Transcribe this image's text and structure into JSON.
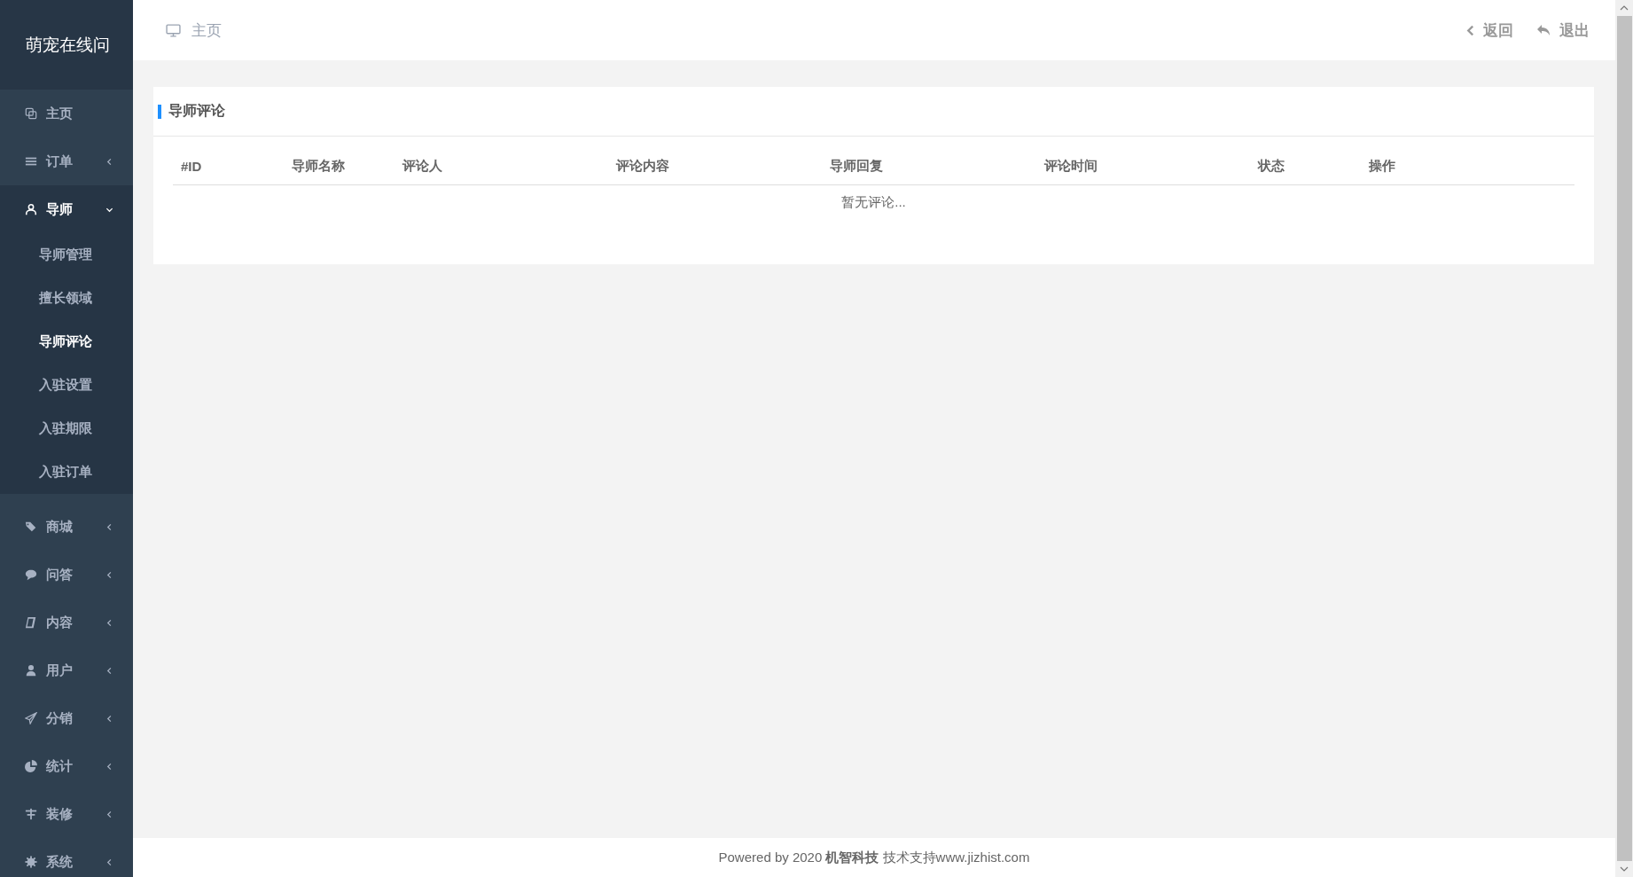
{
  "sidebar": {
    "logo": "萌宠在线问",
    "items": [
      {
        "label": "主页",
        "expanded": false,
        "has_children": false
      },
      {
        "label": "订单",
        "expanded": false,
        "has_children": true
      },
      {
        "label": "导师",
        "expanded": true,
        "has_children": true,
        "children": [
          {
            "label": "导师管理",
            "selected": false
          },
          {
            "label": "擅长领域",
            "selected": false
          },
          {
            "label": "导师评论",
            "selected": true
          },
          {
            "label": "入驻设置",
            "selected": false
          },
          {
            "label": "入驻期限",
            "selected": false
          },
          {
            "label": "入驻订单",
            "selected": false
          }
        ]
      },
      {
        "label": "商城",
        "expanded": false,
        "has_children": true
      },
      {
        "label": "问答",
        "expanded": false,
        "has_children": true
      },
      {
        "label": "内容",
        "expanded": false,
        "has_children": true
      },
      {
        "label": "用户",
        "expanded": false,
        "has_children": true
      },
      {
        "label": "分销",
        "expanded": false,
        "has_children": true
      },
      {
        "label": "统计",
        "expanded": false,
        "has_children": true
      },
      {
        "label": "装修",
        "expanded": false,
        "has_children": true
      },
      {
        "label": "系统",
        "expanded": false,
        "has_children": true
      }
    ]
  },
  "header": {
    "breadcrumb": "主页",
    "actions": [
      "返回",
      "退出"
    ]
  },
  "panel": {
    "title": "导师评论",
    "table": {
      "columns": [
        "#ID",
        "导师名称",
        "评论人",
        "评论内容",
        "导师回复",
        "评论时间",
        "状态",
        "操作"
      ],
      "empty_text": "暂无评论..."
    }
  },
  "footer": {
    "text": "Powered by 2020 **机智科技** 技术支持www.jizhist.com"
  }
}
